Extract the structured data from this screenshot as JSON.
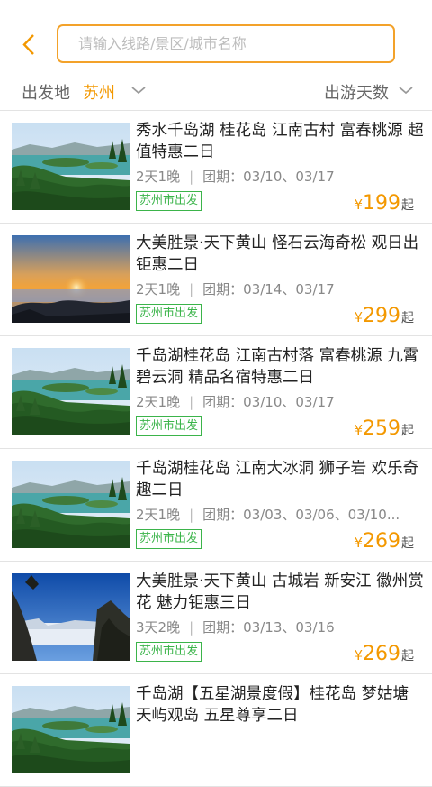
{
  "search": {
    "placeholder": "请输入线路/景区/城市名称"
  },
  "filters": {
    "departure_label": "出发地",
    "departure_value": "苏州",
    "days_label": "出游天数"
  },
  "colors": {
    "accent": "#f39800",
    "tag_green": "#3bb44a",
    "divider": "#e3e3e3"
  },
  "items": [
    {
      "title": "秀水千岛湖 桂花岛 江南古村 富春桃源 超值特惠二日",
      "duration": "2天1晚",
      "dates": "团期：03/10、03/17",
      "tag": "苏州市出发",
      "currency": "¥",
      "price": "199",
      "unit": "起",
      "image": "lake-islands"
    },
    {
      "title": "大美胜景·天下黄山 怪石云海奇松 观日出钜惠二日",
      "duration": "2天1晚",
      "dates": "团期：03/14、03/17",
      "tag": "苏州市出发",
      "currency": "¥",
      "price": "299",
      "unit": "起",
      "image": "sunrise"
    },
    {
      "title": "千岛湖桂花岛 江南古村落 富春桃源 九霄碧云洞 精品名宿特惠二日",
      "duration": "2天1晚",
      "dates": "团期：03/10、03/17",
      "tag": "苏州市出发",
      "currency": "¥",
      "price": "259",
      "unit": "起",
      "image": "lake-islands"
    },
    {
      "title": "千岛湖桂花岛 江南大冰洞 狮子岩 欢乐奇趣二日",
      "duration": "2天1晚",
      "dates": "团期：03/03、03/06、03/10...",
      "tag": "苏州市出发",
      "currency": "¥",
      "price": "269",
      "unit": "起",
      "image": "lake-islands"
    },
    {
      "title": "大美胜景·天下黄山 古城岩 新安江 徽州赏花 魅力钜惠三日",
      "duration": "3天2晚",
      "dates": "团期：03/13、03/16",
      "tag": "苏州市出发",
      "currency": "¥",
      "price": "269",
      "unit": "起",
      "image": "mountain-clouds"
    },
    {
      "title": "千岛湖【五星湖景度假】桂花岛 梦姑塘 天屿观岛 五星尊享二日",
      "duration": "",
      "dates": "",
      "tag": "",
      "currency": "",
      "price": "",
      "unit": "",
      "image": "lake-islands"
    }
  ]
}
